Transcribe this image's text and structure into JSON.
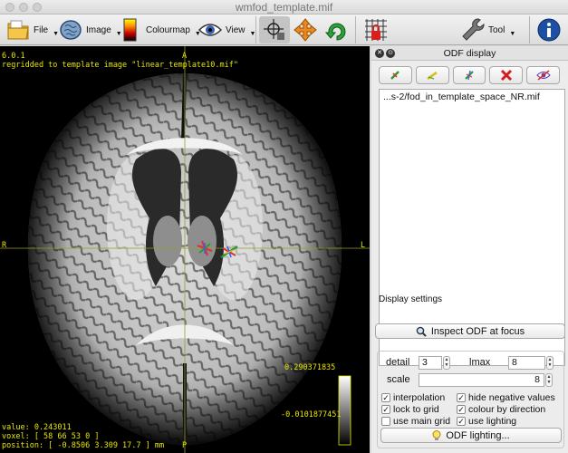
{
  "window": {
    "title": "wmfod_template.mif"
  },
  "toolbar": {
    "file_label": "File",
    "image_label": "Image",
    "colourmap_label": "Colourmap",
    "view_label": "View",
    "tool_label": "Tool"
  },
  "viewer": {
    "version": "6.0.1",
    "regrid_text": "regridded to template image \"linear_template10.mif\"",
    "value_text": "value: 0.243011",
    "voxel_text": "voxel: [ 58 66 53 0 ]",
    "position_text": "position: [ -0.8506 3.309 17.7 ] mm",
    "orient_top": "A",
    "orient_bottom": "P",
    "orient_left": "R",
    "orient_right": "L",
    "colorbar_max": "0.290371835",
    "colorbar_min": "-0.0101877451"
  },
  "odf_panel": {
    "title": "ODF display",
    "files": [
      "...s-2/fod_in_template_space_NR.mif"
    ],
    "inspect_label": "Inspect ODF at focus",
    "display_settings_label": "Display settings",
    "detail_label": "detail",
    "detail_value": "3",
    "lmax_label": "lmax",
    "lmax_value": "8",
    "scale_label": "scale",
    "scale_value": "8",
    "options": {
      "interpolation": "interpolation",
      "hide_negative": "hide negative values",
      "lock_grid": "lock to grid",
      "colour_direction": "colour by direction",
      "main_grid": "use main grid",
      "use_lighting": "use lighting"
    },
    "lighting_label": "ODF lighting..."
  },
  "colors": {
    "overlay_text": "#e6e600",
    "crosshair": "#9a9a30"
  }
}
